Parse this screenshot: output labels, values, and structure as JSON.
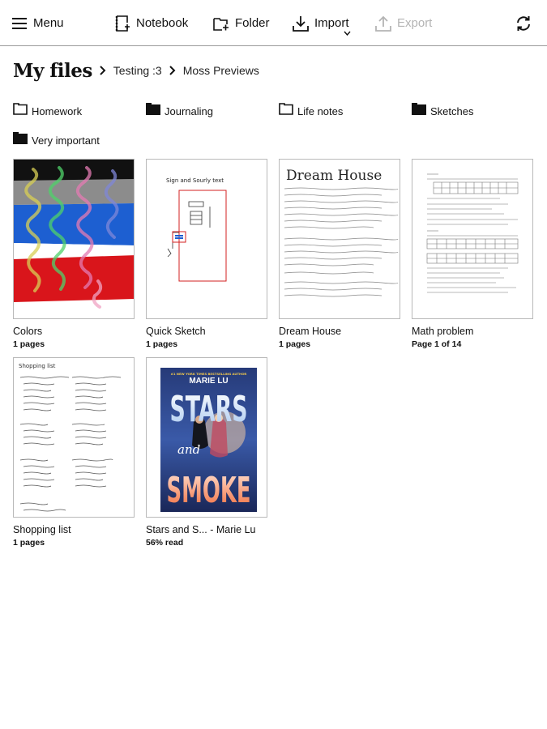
{
  "toolbar": {
    "menu_label": "Menu",
    "notebook_label": "Notebook",
    "folder_label": "Folder",
    "import_label": "Import",
    "export_label": "Export"
  },
  "breadcrumb": {
    "title": "My files",
    "items": [
      "Testing :3",
      "Moss Previews"
    ]
  },
  "folders": [
    {
      "label": "Homework",
      "filled": false
    },
    {
      "label": "Journaling",
      "filled": true
    },
    {
      "label": "Life notes",
      "filled": false
    },
    {
      "label": "Sketches",
      "filled": true
    },
    {
      "label": "Very important",
      "filled": true
    }
  ],
  "documents": [
    {
      "name": "Colors",
      "meta": "1 pages"
    },
    {
      "name": "Quick Sketch",
      "meta": "1 pages"
    },
    {
      "name": "Dream House",
      "meta": "1 pages"
    },
    {
      "name": "Math problem",
      "meta": "Page 1 of 14"
    },
    {
      "name": "Shopping list",
      "meta": "1 pages"
    },
    {
      "name": "Stars and S... - Marie Lu",
      "meta": "56% read",
      "read_percent": 56
    }
  ],
  "thumbnails": {
    "quick_sketch_heading": "Sign and Sourly text",
    "dream_house_heading": "Dream House",
    "shopping_heading": "Shopping list",
    "book_author": "MARIE LU",
    "book_banner": "#1 NEW YORK TIMES BESTSELLING AUTHOR",
    "book_title_top": "STARS",
    "book_title_and": "and",
    "book_title_bottom": "SMOKE"
  },
  "colors": {
    "accent": "#111111",
    "disabled": "#b4b4b4",
    "border": "#b9b9b9"
  }
}
